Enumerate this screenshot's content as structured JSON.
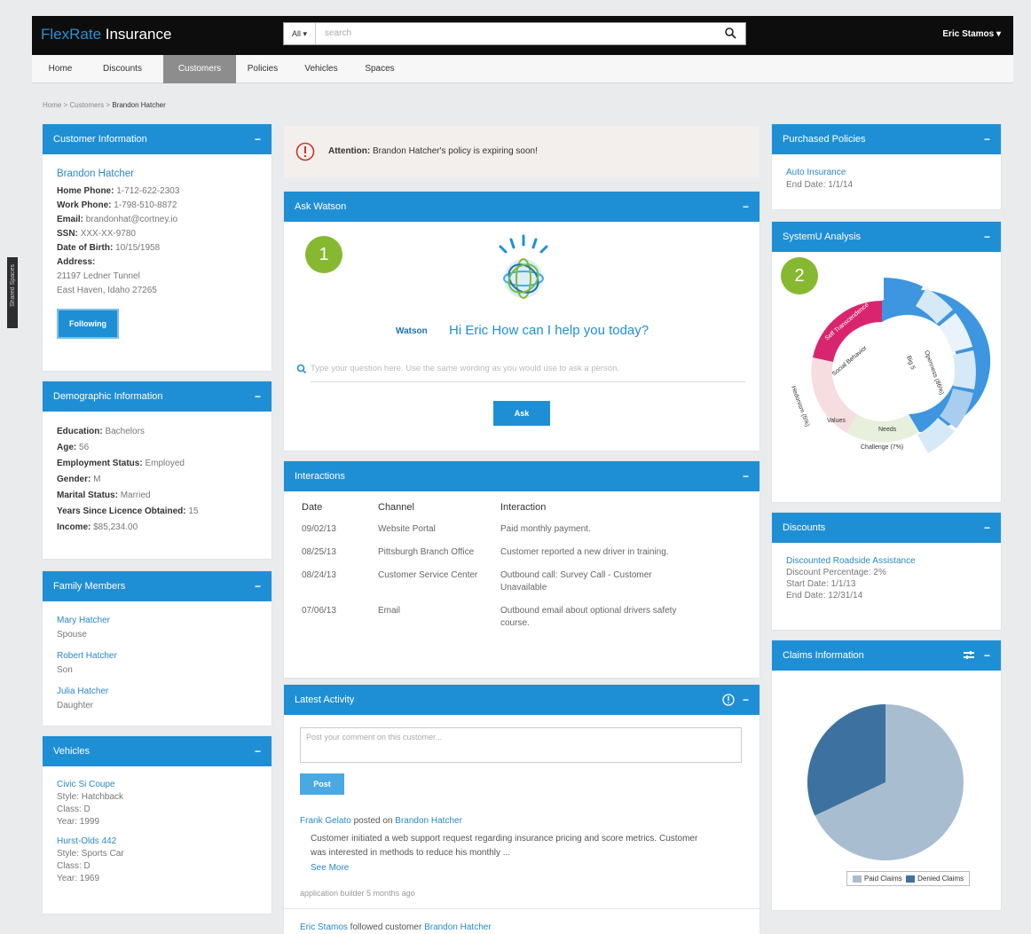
{
  "header": {
    "brand_prefix": "FlexRate",
    "brand_suffix": " Insurance",
    "search_scope": "All ▾",
    "search_placeholder": "search",
    "user": "Eric Stamos ▾"
  },
  "nav": {
    "tabs": [
      "Home",
      "Discounts",
      "Customers",
      "Policies",
      "Vehicles",
      "Spaces"
    ],
    "active": "Customers"
  },
  "breadcrumb": {
    "home": "Home",
    "sep": ">",
    "customers": "Customers",
    "current": "Brandon Hatcher"
  },
  "sidetab": "Shared Spaces",
  "customer_info": {
    "title": "Customer Information",
    "name": "Brandon Hatcher",
    "home_phone_label": "Home Phone:",
    "home_phone": "1-712-622-2303",
    "work_phone_label": "Work Phone:",
    "work_phone": "1-798-510-8872",
    "email_label": "Email:",
    "email": "brandonhat@cortney.io",
    "ssn_label": "SSN:",
    "ssn": "XXX-XX-9780",
    "dob_label": "Date of Birth:",
    "dob": "10/15/1958",
    "address_label": "Address:",
    "address1": "21197 Ledner Tunnel",
    "address2": "East Haven, Idaho 27265",
    "follow_button": "Following"
  },
  "demographic": {
    "title": "Demographic Information",
    "education_label": "Education:",
    "education": "Bachelors",
    "age_label": "Age:",
    "age": "56",
    "employment_label": "Employment Status:",
    "employment": "Employed",
    "gender_label": "Gender:",
    "gender": "M",
    "marital_label": "Marital Status:",
    "marital": "Married",
    "years_label": "Years Since Licence Obtained:",
    "years": "15",
    "income_label": "Income:",
    "income": "$85,234.00"
  },
  "family": {
    "title": "Family Members",
    "members": [
      {
        "name": "Mary Hatcher",
        "relation": "Spouse"
      },
      {
        "name": "Robert Hatcher",
        "relation": "Son"
      },
      {
        "name": "Julia Hatcher",
        "relation": "Daughter"
      }
    ]
  },
  "vehicles": {
    "title": "Vehicles",
    "items": [
      {
        "name": "Civic Si Coupe",
        "style": "Style: Hatchback",
        "class": "Class: D",
        "year": "Year: 1999"
      },
      {
        "name": "Hurst-Olds 442",
        "style": "Style: Sports Car",
        "class": "Class: D",
        "year": "Year: 1969"
      }
    ]
  },
  "alert": {
    "label": "Attention:",
    "text": " Brandon Hatcher's policy is expiring soon!"
  },
  "watson": {
    "title": "Ask Watson",
    "badge": "1",
    "name": "Watson",
    "greeting": "Hi Eric How can I help you today?",
    "placeholder": "Type your question here. Use the same wording as you would use to ask a person.",
    "ask_button": "Ask"
  },
  "interactions": {
    "title": "Interactions",
    "headers": [
      "Date",
      "Channel",
      "Interaction"
    ],
    "rows": [
      [
        "09/02/13",
        "Website Portal",
        "Paid monthly payment."
      ],
      [
        "08/25/13",
        "Pittsburgh Branch Office",
        "Customer reported a new driver in training."
      ],
      [
        "08/24/13",
        "Customer Service Center",
        "Outbound call: Survey Call - Customer Unavailable"
      ],
      [
        "07/06/13",
        "Email",
        "Outbound email about optional drivers safety course."
      ]
    ]
  },
  "activity": {
    "title": "Latest Activity",
    "comment_placeholder": "Post your comment on this customer...",
    "post_button": "Post",
    "entry_author": "Frank Gelato",
    "entry_verb": " posted on ",
    "entry_target": "Brandon Hatcher",
    "entry_text": "Customer initiated a web support request regarding insurance pricing and score metrics. Customer was interested in methods to reduce his monthly ...",
    "see_more": "See More",
    "entry_meta": "application builder 5 months ago",
    "entry2_author": "Eric Stamos",
    "entry2_verb": " followed customer ",
    "entry2_target": "Brandon Hatcher"
  },
  "policies": {
    "title": "Purchased Policies",
    "name": "Auto Insurance",
    "end": "End Date: 1/1/14"
  },
  "systemu": {
    "title": "SystemU Analysis",
    "badge": "2",
    "inner": [
      "Social Behavior",
      "Values",
      "Needs",
      "Big 5"
    ],
    "outer": [
      "Self Transcendence",
      "Hedonism (5%)",
      "Challenge (7%)",
      "Openness (86%)",
      "Neuroticism (9%)",
      "Conscientiousness (7%)",
      "Extraversion (5%)",
      "Agreeableness (7%)",
      "Openness (40%)"
    ]
  },
  "discounts": {
    "title": "Discounts",
    "name": "Discounted Roadside Assistance",
    "pct": "Discount Percentage: 2%",
    "start": "Start Date: 1/1/13",
    "end": "End Date: 12/31/14"
  },
  "claims": {
    "title": "Claims Information",
    "legend_paid": "Paid Claims",
    "legend_denied": "Denied Claims",
    "colors": {
      "paid": "#a9bdd0",
      "denied": "#3d72a0"
    }
  },
  "chart_data": {
    "type": "pie",
    "categories": [
      "Paid Claims",
      "Denied Claims"
    ],
    "values": [
      68,
      32
    ]
  }
}
